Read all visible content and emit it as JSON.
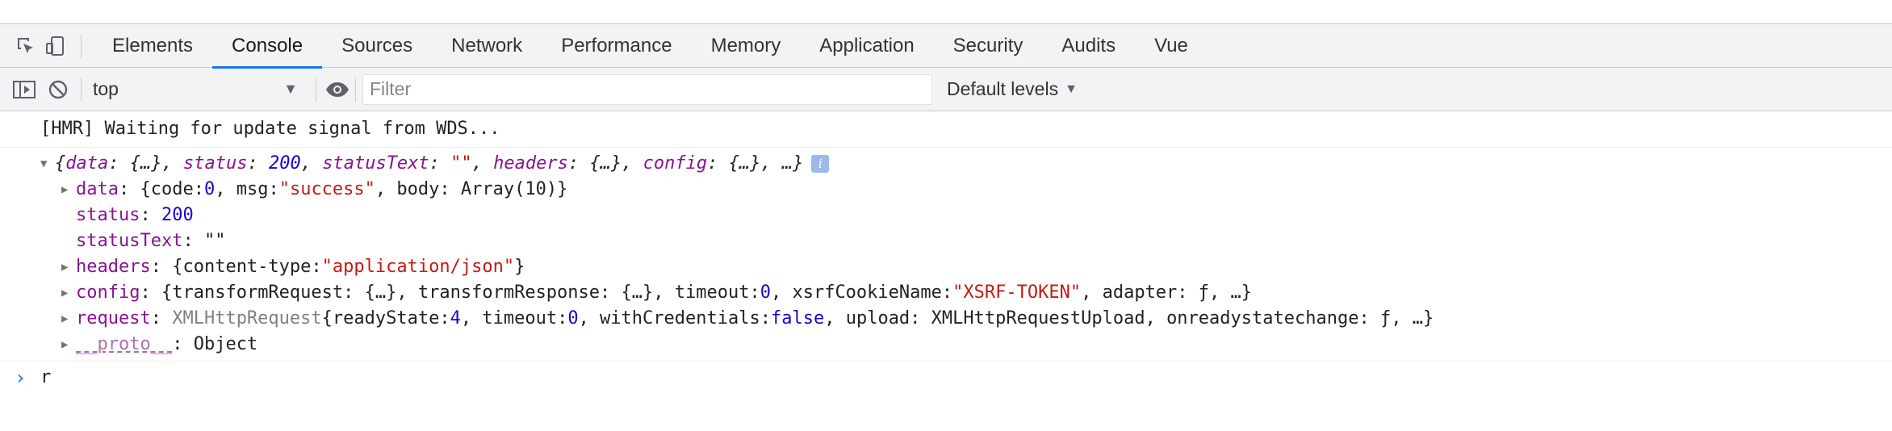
{
  "tabs": {
    "items": [
      {
        "label": "Elements"
      },
      {
        "label": "Console"
      },
      {
        "label": "Sources"
      },
      {
        "label": "Network"
      },
      {
        "label": "Performance"
      },
      {
        "label": "Memory"
      },
      {
        "label": "Application"
      },
      {
        "label": "Security"
      },
      {
        "label": "Audits"
      },
      {
        "label": "Vue"
      }
    ],
    "active": "Console"
  },
  "toolbar": {
    "context": "top",
    "filter_placeholder": "Filter",
    "levels_label": "Default levels"
  },
  "console": {
    "hmr": "[HMR] Waiting for update signal from WDS...",
    "summary": {
      "open": "{",
      "k1": "data",
      "v1": "{…}",
      "k2": "status",
      "v2": "200",
      "k3": "statusText",
      "v3": "\"\"",
      "k4": "headers",
      "v4": "{…}",
      "k5": "config",
      "v5": "{…}",
      "tail": ", …}"
    },
    "data_line": {
      "key": "data",
      "p1": "{code: ",
      "code": "0",
      "p2": ", msg: ",
      "msg": "\"success\"",
      "p3": ", body: Array(10)}"
    },
    "status_line": {
      "key": "status",
      "value": "200"
    },
    "statusText_line": {
      "key": "statusText",
      "value": "\"\""
    },
    "headers_line": {
      "key": "headers",
      "p1": "{content-type: ",
      "ct": "\"application/json\"",
      "p2": "}"
    },
    "config_line": {
      "key": "config",
      "p1": "{transformRequest: {…}, transformResponse: {…}, timeout: ",
      "timeout": "0",
      "p2": ", xsrfCookieName: ",
      "cookie": "\"XSRF-TOKEN\"",
      "p3": ", adapter: ƒ, …}"
    },
    "request_line": {
      "key": "request",
      "cls": "XMLHttpRequest",
      "p1": " {readyState: ",
      "rs": "4",
      "p2": ", timeout: ",
      "timeout": "0",
      "p3": ", withCredentials: ",
      "wc": "false",
      "p4": ", upload: XMLHttpRequestUpload, onreadystatechange: ƒ, …}"
    },
    "proto_line": {
      "key": "__proto__",
      "value": "Object"
    },
    "prompt_text": "r"
  }
}
